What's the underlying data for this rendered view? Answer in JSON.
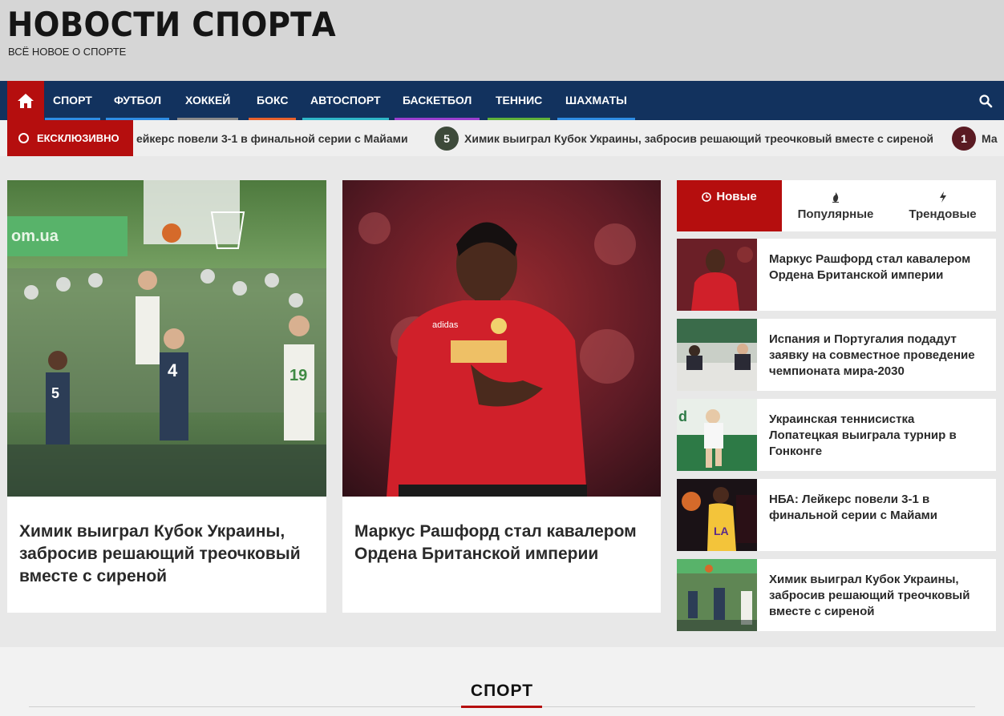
{
  "site": {
    "title": "НОВОСТИ СПОРТА",
    "tagline": "ВСЁ НОВОЕ О СПОРТЕ"
  },
  "nav": {
    "items": [
      {
        "label": "СПОРТ",
        "color": "#2f8de4"
      },
      {
        "label": "ФУТБОЛ",
        "color": "#2f8de4"
      },
      {
        "label": "ХОККЕЙ",
        "color": "#8a8a8a"
      },
      {
        "label": "БОКС",
        "color": "#e8622c"
      },
      {
        "label": "АВТОСПОРТ",
        "color": "#2fb6c8"
      },
      {
        "label": "БАСКЕТБОЛ",
        "color": "#9b3fd0"
      },
      {
        "label": "ТЕННИС",
        "color": "#5fb13a"
      },
      {
        "label": "ШАХМАТЫ",
        "color": "#2f8de4"
      }
    ]
  },
  "ticker": {
    "label": "ЕКСКЛЮЗИВНО",
    "items": [
      {
        "num": "",
        "text": "ейкерс повели 3-1 в финальной серии с Майами"
      },
      {
        "num": "5",
        "text": "Химик выиграл Кубок Украины, забросив решающий треочковый вместе с сиреной"
      },
      {
        "num": "1",
        "text": "Ма"
      }
    ]
  },
  "featured": [
    {
      "title": "Химик выиграл Кубок Украины, забросив решающий треочковый вместе с сиреной",
      "image": "basketball-game-photo"
    },
    {
      "title": "Маркус Рашфорд стал кавалером Ордена Британской империи",
      "image": "footballer-red-kit-photo"
    }
  ],
  "tabs": [
    {
      "label": "Новые",
      "icon": "clock-icon"
    },
    {
      "label": "Популярные",
      "icon": "fire-icon"
    },
    {
      "label": "Трендовые",
      "icon": "bolt-icon"
    }
  ],
  "sidebar": {
    "posts": [
      {
        "title": "Маркус Рашфорд стал кавалером Ордена Британской империи",
        "image": "footballer-thumb"
      },
      {
        "title": "Испания и Португалия подадут заявку на совместное проведение чемпионата мира-2030",
        "image": "press-conference-thumb"
      },
      {
        "title": "Украинская теннисистка Лопатецкая выиграла турнир в Гонконге",
        "image": "tennis-player-thumb"
      },
      {
        "title": "НБА: Лейкерс повели 3-1 в финальной серии с Майами",
        "image": "nba-game-thumb"
      },
      {
        "title": "Химик выиграл Кубок Украины, забросив решающий треочковый вместе с сиреной",
        "image": "basketball-thumb"
      }
    ]
  },
  "section": {
    "title": "СПОРТ"
  },
  "colors": {
    "accent": "#b50e0e",
    "nav_bg": "#12325e",
    "header_bg": "#d6d6d6"
  }
}
